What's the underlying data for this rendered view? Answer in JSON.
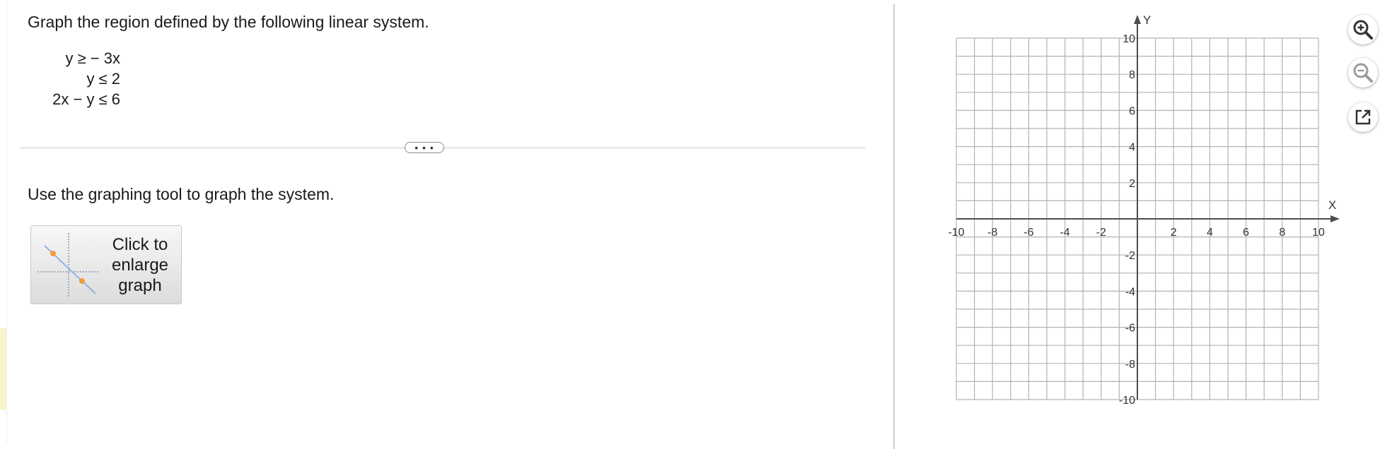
{
  "question": {
    "title": "Graph the region defined by the following linear system.",
    "system": [
      "y ≥ − 3x",
      "y ≤ 2",
      "2x − y ≤ 6"
    ]
  },
  "more_button_label": "• • •",
  "instruction": "Use the graphing tool to graph the system.",
  "enlarge_button": {
    "label": "Click to enlarge graph",
    "icon": "graph-thumbnail-icon"
  },
  "graph": {
    "x_axis_label": "X",
    "y_axis_label": "Y",
    "x_range": [
      -10,
      10
    ],
    "y_range": [
      -10,
      10
    ],
    "grid_step": 1,
    "x_tick_labels": [
      "-10",
      "-8",
      "-6",
      "-4",
      "-2",
      "2",
      "4",
      "6",
      "8",
      "10"
    ],
    "y_tick_labels": [
      "10",
      "8",
      "6",
      "4",
      "2",
      "-2",
      "-4",
      "-6",
      "-8",
      "-10"
    ]
  },
  "tools": [
    {
      "name": "zoom-in",
      "icon": "zoom-in-icon"
    },
    {
      "name": "zoom-out",
      "icon": "zoom-out-icon"
    },
    {
      "name": "pop-out",
      "icon": "external-link-icon"
    }
  ],
  "colors": {
    "grid_line": "#b3b3b3",
    "axis_line": "#4d4d4d",
    "accent_line": "#8fb4e3",
    "accent_point": "#f39a3c",
    "tool_icon": "#333333",
    "question_highlight": "#fbf3cf"
  }
}
